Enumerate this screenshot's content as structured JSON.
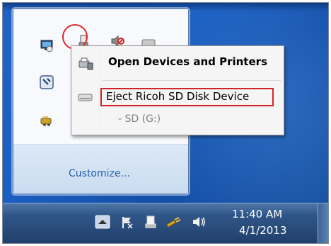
{
  "context_menu": {
    "open_devices_label": "Open Devices and Printers",
    "eject_label": "Eject Ricoh SD Disk Device",
    "sub_item_label": "- SD (G:)"
  },
  "tray_flyout": {
    "customize_label": "Customize..."
  },
  "taskbar": {
    "clock_time": "11:40 AM",
    "clock_date": "4/1/2013"
  },
  "icons": {
    "flyout": [
      "network-monitor-icon",
      "usb-device-icon",
      "volume-muted-icon",
      "drive-icon",
      "tool-icon",
      "printer-key-icon"
    ],
    "taskbar": [
      "show-hidden-icons-icon",
      "action-center-flag-icon",
      "safely-remove-hardware-icon",
      "power-plug-icon",
      "volume-icon"
    ]
  },
  "colors": {
    "highlight_box": "#d2232a",
    "link": "#1f5fa8"
  }
}
